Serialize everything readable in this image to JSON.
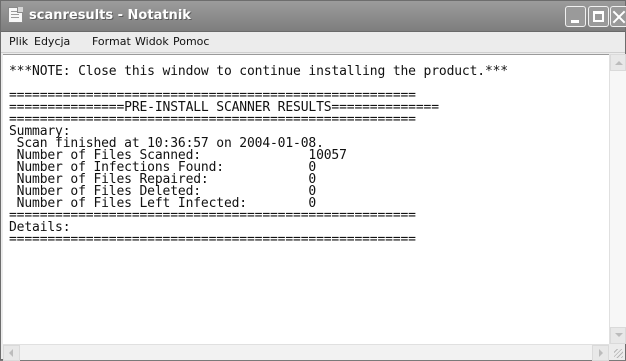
{
  "window": {
    "title": "scanresults - Notatnik"
  },
  "menu": [
    "Plik",
    "Edycja",
    "Format",
    "Widok",
    "Pomoc"
  ],
  "document": {
    "text": "***NOTE: Close this window to continue installing the product.***\n\n=====================================================\n===============PRE-INSTALL SCANNER RESULTS==============\n=====================================================\nSummary:\n Scan finished at 10:36:57 on 2004-01-08.\n Number of Files Scanned:              10057\n Number of Infections Found:           0\n Number of Files Repaired:             0\n Number of Files Deleted:              0\n Number of Files Left Infected:        0\n=====================================================\nDetails:\n====================================================="
  },
  "icons": {
    "app": "notepad-icon",
    "minimize": "minimize-icon",
    "maximize": "maximize-icon",
    "close": "close-icon"
  }
}
